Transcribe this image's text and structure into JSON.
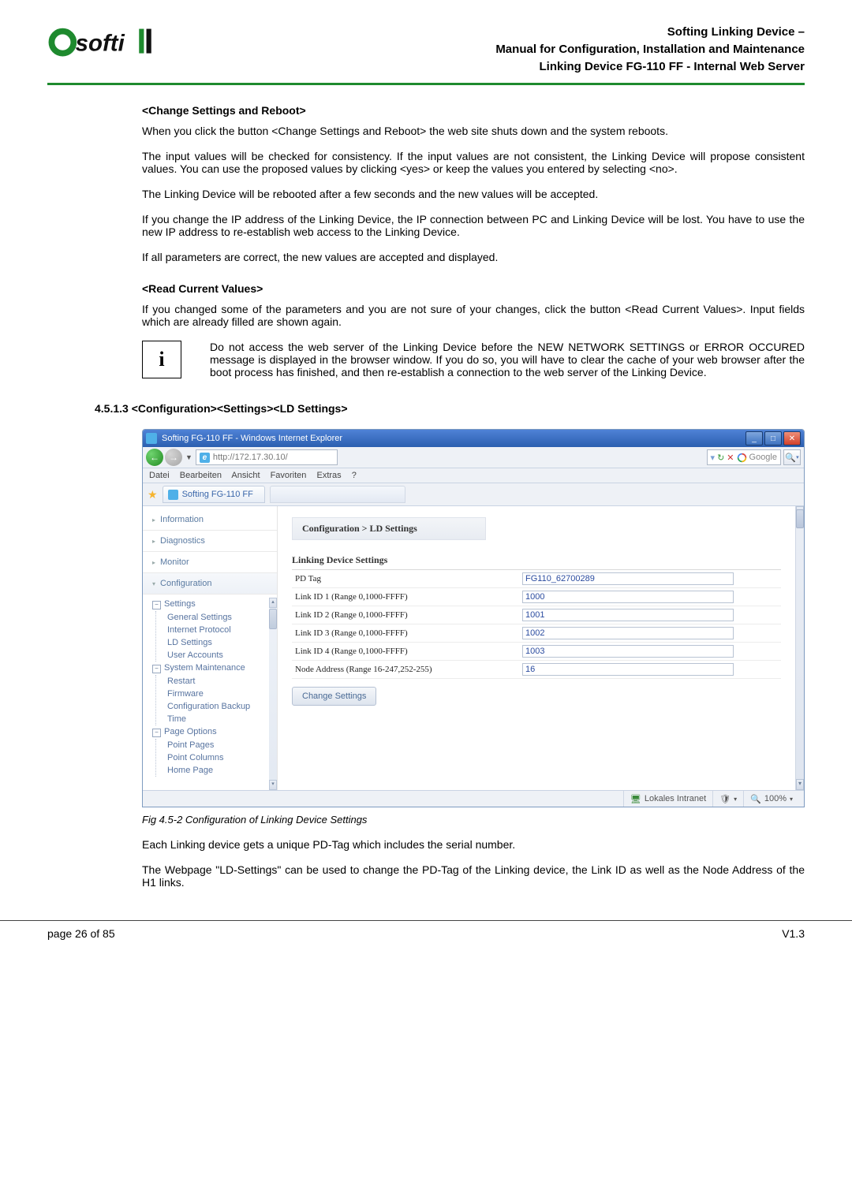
{
  "header": {
    "company": "Softing",
    "title_l1": "Softing Linking Device –",
    "title_l2": "Manual for Configuration, Installation and Maintenance",
    "title_l3": "Linking Device FG-110 FF - Internal Web Server"
  },
  "body": {
    "s1_title": "<Change Settings and Reboot>",
    "s1_p1": "When you click the button <Change Settings and Reboot> the web site shuts down and the system reboots.",
    "s1_p2": "The input values will be checked for consistency. If the input values are not consistent, the Linking Device will propose consistent values. You can use the proposed values by clicking <yes> or keep the values you entered by selecting <no>.",
    "s1_p3": "The Linking Device will be rebooted after a few seconds and the new values will be accepted.",
    "s1_p4": "If you change the IP address of the Linking Device, the IP connection between PC and Linking Device will be lost. You have to use the new IP address to re-establish web access to the Linking Device.",
    "s1_p5": "If all parameters are correct, the new values are accepted and displayed.",
    "s2_title": "<Read Current Values>",
    "s2_p1": "If you changed some of the parameters and you are not sure of your changes, click the button <Read Current Values>. Input fields which are already filled are shown again.",
    "info_icon": "i",
    "info_text": "Do not access the web server of the Linking Device before the NEW NETWORK SETTINGS or ERROR OCCURED message is displayed in the browser window. If you do so, you will have to clear the cache of your web browser after the boot process has finished, and then re-establish a connection to the web server of the Linking Device.",
    "h4": "4.5.1.3   <Configuration><Settings><LD Settings>",
    "fig_caption": "Fig 4.5-2  Configuration of Linking Device Settings",
    "p_after1": "Each Linking device gets a unique PD-Tag which includes the serial number.",
    "p_after2": "The Webpage \"LD-Settings\" can be used to change the PD-Tag of the Linking device, the Link ID as well as the Node Address of the H1 links."
  },
  "ie": {
    "window_title": "Softing FG-110 FF - Windows Internet Explorer",
    "address": "http://172.17.30.10/",
    "menu": [
      "Datei",
      "Bearbeiten",
      "Ansicht",
      "Favoriten",
      "Extras",
      "?"
    ],
    "tab_label": "Softing FG-110 FF",
    "search_placeholder": "Google",
    "sidebar_sections": [
      "Information",
      "Diagnostics",
      "Monitor",
      "Configuration"
    ],
    "tree": {
      "settings": "Settings",
      "settings_children": [
        "General Settings",
        "Internet Protocol",
        "LD Settings",
        "User Accounts"
      ],
      "sysmaint": "System Maintenance",
      "sysmaint_children": [
        "Restart",
        "Firmware",
        "Configuration Backup",
        "Time"
      ],
      "pageopt": "Page Options",
      "pageopt_children": [
        "Point Pages",
        "Point Columns",
        "Home Page"
      ]
    },
    "breadcrumb": "Configuration > LD Settings",
    "table_title": "Linking Device Settings",
    "rows": [
      {
        "label": "PD Tag",
        "value": "FG110_62700289"
      },
      {
        "label": "Link ID 1 (Range 0,1000-FFFF)",
        "value": "1000"
      },
      {
        "label": "Link ID 2 (Range 0,1000-FFFF)",
        "value": "1001"
      },
      {
        "label": "Link ID 3 (Range 0,1000-FFFF)",
        "value": "1002"
      },
      {
        "label": "Link ID 4 (Range 0,1000-FFFF)",
        "value": "1003"
      },
      {
        "label": "Node Address (Range 16-247,252-255)",
        "value": "16"
      }
    ],
    "change_btn": "Change Settings",
    "status_zone": "Lokales Intranet",
    "status_zoom": "100%"
  },
  "footer": {
    "left": "page 26 of 85",
    "right": "V1.3"
  }
}
